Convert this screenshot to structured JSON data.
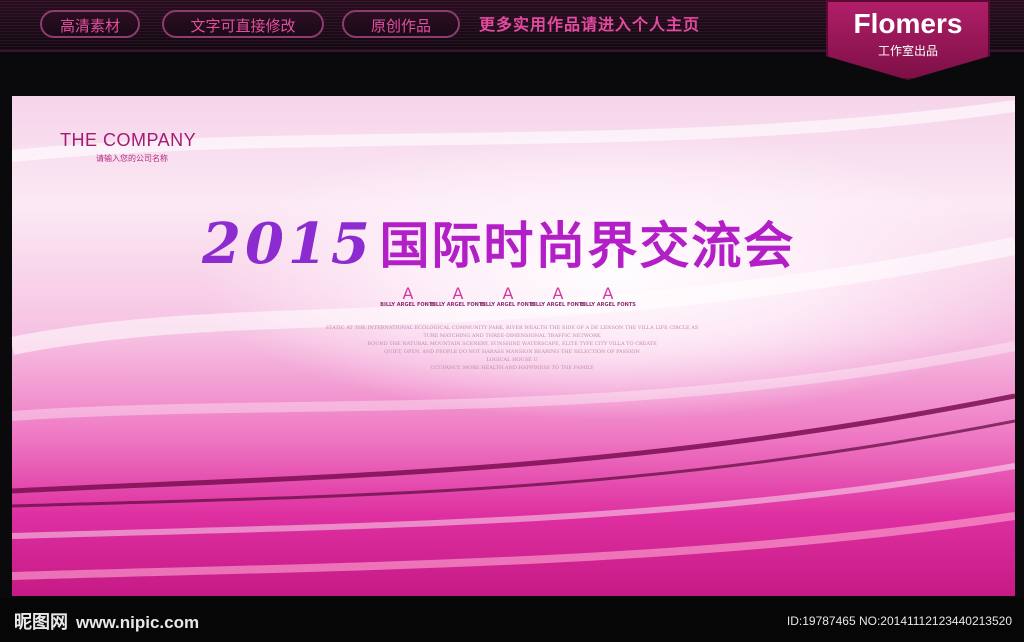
{
  "topbar": {
    "pills": [
      "高清素材",
      "文字可直接修改",
      "原创作品"
    ],
    "promo": "更多实用作品请进入个人主页"
  },
  "brand": {
    "name": "Flomers",
    "sub": "工作室出品"
  },
  "banner": {
    "company": "THE COMPANY",
    "company_sub": "请输入您的公司名称",
    "year": "2015",
    "title": "国际时尚界交流会",
    "stars": [
      {
        "glyph": "A",
        "caption": "BILLY ARGEL FONTS"
      },
      {
        "glyph": "A",
        "caption": "BILLY ARGEL FONTS"
      },
      {
        "glyph": "A",
        "caption": "BILLY ARGEL FONTS"
      },
      {
        "glyph": "A",
        "caption": "BILLY ARGEL FONTS"
      },
      {
        "glyph": "A",
        "caption": "BILLY ARGEL FONTS"
      }
    ],
    "fine_lines": [
      "STATIC AT THE INTERNATIONAL ECOLOGICAL COMMUNITY PARK, RIVER WEALTH THE SIDE OF A DE LENSON THE VILLA LIFE CIRCLE AS",
      "TURE MATCHING AND THREE-DIMENSIONAL TRAFFIC NETWORK",
      "BOUND THE NATURAL MOUNTAIN SCENERY, SUNSHINE WATERSCAPE, ELITE TYPE CITY VILLA TO CREATE",
      "QUIET, OPEN, AND PEOPLE DO NOT HARASS MANSION BEARING THE SELECTION OF PASSION",
      "LOGICAL HOUSE U",
      "CCUPANCY, MORE HEALTH AND HAPPINESS TO THE FAMILY"
    ]
  },
  "footer": {
    "site_cn": "昵图网",
    "site_url": "www.nipic.com",
    "id_info": "ID:19787465 NO:20141112123440213520"
  },
  "colors": {
    "accent": "#e24f9f",
    "brand_bg": "#b21f6a",
    "title_purple": "#8c2bd0",
    "title_magenta": "#b21fc6"
  }
}
